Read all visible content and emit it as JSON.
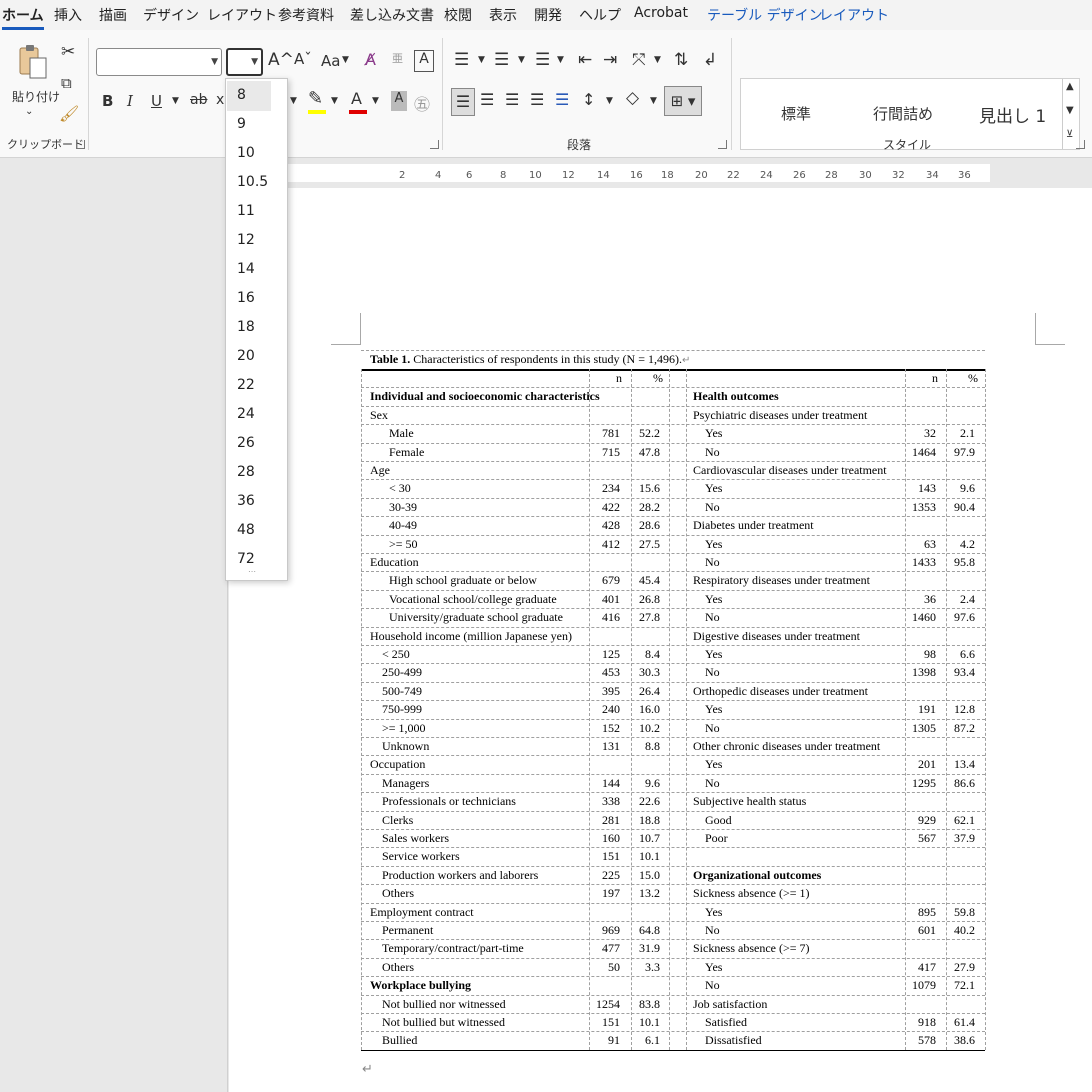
{
  "tabs": [
    {
      "label": "ホーム",
      "active": true
    },
    {
      "label": "挿入"
    },
    {
      "label": "描画"
    },
    {
      "label": "デザイン"
    },
    {
      "label": "レイアウト"
    },
    {
      "label": "参考資料"
    },
    {
      "label": "差し込み文書"
    },
    {
      "label": "校閲"
    },
    {
      "label": "表示"
    },
    {
      "label": "開発"
    },
    {
      "label": "ヘルプ"
    },
    {
      "label": "Acrobat"
    },
    {
      "label": "テーブル デザイン",
      "contextual": true
    },
    {
      "label": "レイアウト",
      "contextual": true
    }
  ],
  "ribbon": {
    "clipboard": {
      "paste_label": "貼り付け",
      "group_label": "クリップボード"
    },
    "font": {
      "font_name_value": "",
      "font_size_value": "",
      "grow_icon": "A^",
      "shrink_icon": "Aˇ",
      "case_label": "Aa",
      "bold": "B",
      "italic": "I",
      "underline": "U",
      "strike": "ab",
      "highlight_color": "#ffff00",
      "font_color": "#e00000"
    },
    "paragraph": {
      "group_label": "段落"
    },
    "styles": {
      "group_label": "スタイル",
      "items": [
        "標準",
        "行間詰め",
        "見出し 1"
      ]
    }
  },
  "font_size_dropdown": {
    "options": [
      "8",
      "9",
      "10",
      "10.5",
      "11",
      "12",
      "14",
      "16",
      "18",
      "20",
      "22",
      "24",
      "26",
      "28",
      "36",
      "48",
      "72"
    ],
    "highlighted": "8"
  },
  "ruler": {
    "labels": [
      "2",
      "4",
      "6",
      "8",
      "10",
      "12",
      "14",
      "16",
      "18",
      "20",
      "22",
      "24",
      "26",
      "28",
      "30",
      "32",
      "34",
      "36"
    ]
  },
  "table": {
    "caption_bold": "Table 1.",
    "caption_rest": " Characteristics of respondents in this study (N = 1,496).",
    "header": {
      "n": "n",
      "pct": "%"
    },
    "left": [
      {
        "label": "Individual and socioeconomic characteristics",
        "bold": true,
        "indent": 0
      },
      {
        "label": "Sex",
        "indent": 0
      },
      {
        "label": "Male",
        "indent": 2,
        "n": "781",
        "pct": "52.2"
      },
      {
        "label": "Female",
        "indent": 2,
        "n": "715",
        "pct": "47.8"
      },
      {
        "label": "Age",
        "indent": 0
      },
      {
        "label": "< 30",
        "indent": 2,
        "n": "234",
        "pct": "15.6"
      },
      {
        "label": "30-39",
        "indent": 2,
        "n": "422",
        "pct": "28.2"
      },
      {
        "label": "40-49",
        "indent": 2,
        "n": "428",
        "pct": "28.6"
      },
      {
        "label": ">= 50",
        "indent": 2,
        "n": "412",
        "pct": "27.5"
      },
      {
        "label": "Education",
        "indent": 0
      },
      {
        "label": "High school graduate or below",
        "indent": 2,
        "n": "679",
        "pct": "45.4"
      },
      {
        "label": "Vocational school/college graduate",
        "indent": 2,
        "n": "401",
        "pct": "26.8"
      },
      {
        "label": "University/graduate school graduate",
        "indent": 2,
        "n": "416",
        "pct": "27.8"
      },
      {
        "label": "Household income (million Japanese yen)",
        "indent": 0
      },
      {
        "label": "< 250",
        "indent": 1,
        "n": "125",
        "pct": "8.4"
      },
      {
        "label": "250-499",
        "indent": 1,
        "n": "453",
        "pct": "30.3"
      },
      {
        "label": "500-749",
        "indent": 1,
        "n": "395",
        "pct": "26.4"
      },
      {
        "label": "750-999",
        "indent": 1,
        "n": "240",
        "pct": "16.0"
      },
      {
        "label": ">= 1,000",
        "indent": 1,
        "n": "152",
        "pct": "10.2"
      },
      {
        "label": "Unknown",
        "indent": 1,
        "n": "131",
        "pct": "8.8"
      },
      {
        "label": "Occupation",
        "indent": 0
      },
      {
        "label": "Managers",
        "indent": 1,
        "n": "144",
        "pct": "9.6"
      },
      {
        "label": "Professionals or technicians",
        "indent": 1,
        "n": "338",
        "pct": "22.6"
      },
      {
        "label": "Clerks",
        "indent": 1,
        "n": "281",
        "pct": "18.8"
      },
      {
        "label": "Sales workers",
        "indent": 1,
        "n": "160",
        "pct": "10.7"
      },
      {
        "label": "Service workers",
        "indent": 1,
        "n": "151",
        "pct": "10.1"
      },
      {
        "label": "Production workers and laborers",
        "indent": 1,
        "n": "225",
        "pct": "15.0"
      },
      {
        "label": "Others",
        "indent": 1,
        "n": "197",
        "pct": "13.2"
      },
      {
        "label": "Employment contract",
        "indent": 0
      },
      {
        "label": "Permanent",
        "indent": 1,
        "n": "969",
        "pct": "64.8"
      },
      {
        "label": "Temporary/contract/part-time",
        "indent": 1,
        "n": "477",
        "pct": "31.9"
      },
      {
        "label": "Others",
        "indent": 1,
        "n": "50",
        "pct": "3.3"
      },
      {
        "label": "Workplace bullying",
        "bold": true,
        "indent": 0
      },
      {
        "label": "Not bullied nor witnessed",
        "indent": 1,
        "n": "1254",
        "pct": "83.8"
      },
      {
        "label": "Not bullied but witnessed",
        "indent": 1,
        "n": "151",
        "pct": "10.1"
      },
      {
        "label": "Bullied",
        "indent": 1,
        "n": "91",
        "pct": "6.1"
      }
    ],
    "right": [
      {
        "label": "Health outcomes",
        "bold": true,
        "indent": 0
      },
      {
        "label": "Psychiatric diseases under treatment",
        "indent": 0
      },
      {
        "label": "Yes",
        "indent": 1,
        "n": "32",
        "pct": "2.1"
      },
      {
        "label": "No",
        "indent": 1,
        "n": "1464",
        "pct": "97.9"
      },
      {
        "label": "Cardiovascular diseases under treatment",
        "indent": 0
      },
      {
        "label": "Yes",
        "indent": 1,
        "n": "143",
        "pct": "9.6"
      },
      {
        "label": "No",
        "indent": 1,
        "n": "1353",
        "pct": "90.4"
      },
      {
        "label": "Diabetes under treatment",
        "indent": 0
      },
      {
        "label": "Yes",
        "indent": 1,
        "n": "63",
        "pct": "4.2"
      },
      {
        "label": "No",
        "indent": 1,
        "n": "1433",
        "pct": "95.8"
      },
      {
        "label": "Respiratory diseases under treatment",
        "indent": 0
      },
      {
        "label": "Yes",
        "indent": 1,
        "n": "36",
        "pct": "2.4"
      },
      {
        "label": "No",
        "indent": 1,
        "n": "1460",
        "pct": "97.6"
      },
      {
        "label": "Digestive diseases under treatment",
        "indent": 0
      },
      {
        "label": "Yes",
        "indent": 1,
        "n": "98",
        "pct": "6.6"
      },
      {
        "label": "No",
        "indent": 1,
        "n": "1398",
        "pct": "93.4"
      },
      {
        "label": "Orthopedic diseases under treatment",
        "indent": 0
      },
      {
        "label": "Yes",
        "indent": 1,
        "n": "191",
        "pct": "12.8"
      },
      {
        "label": "No",
        "indent": 1,
        "n": "1305",
        "pct": "87.2"
      },
      {
        "label": "Other chronic diseases under treatment",
        "indent": 0
      },
      {
        "label": "Yes",
        "indent": 1,
        "n": "201",
        "pct": "13.4"
      },
      {
        "label": "No",
        "indent": 1,
        "n": "1295",
        "pct": "86.6"
      },
      {
        "label": "Subjective health status",
        "indent": 0
      },
      {
        "label": "Good",
        "indent": 1,
        "n": "929",
        "pct": "62.1"
      },
      {
        "label": "Poor",
        "indent": 1,
        "n": "567",
        "pct": "37.9"
      },
      {
        "label": "",
        "indent": 0
      },
      {
        "label": "Organizational outcomes",
        "bold": true,
        "indent": 0
      },
      {
        "label": "Sickness absence (>= 1)",
        "indent": 0
      },
      {
        "label": "Yes",
        "indent": 1,
        "n": "895",
        "pct": "59.8"
      },
      {
        "label": "No",
        "indent": 1,
        "n": "601",
        "pct": "40.2"
      },
      {
        "label": "Sickness absence (>= 7)",
        "indent": 0
      },
      {
        "label": "Yes",
        "indent": 1,
        "n": "417",
        "pct": "27.9"
      },
      {
        "label": "No",
        "indent": 1,
        "n": "1079",
        "pct": "72.1"
      },
      {
        "label": "Job satisfaction",
        "indent": 0
      },
      {
        "label": "Satisfied",
        "indent": 1,
        "n": "918",
        "pct": "61.4"
      },
      {
        "label": "Dissatisfied",
        "indent": 1,
        "n": "578",
        "pct": "38.6"
      }
    ]
  }
}
